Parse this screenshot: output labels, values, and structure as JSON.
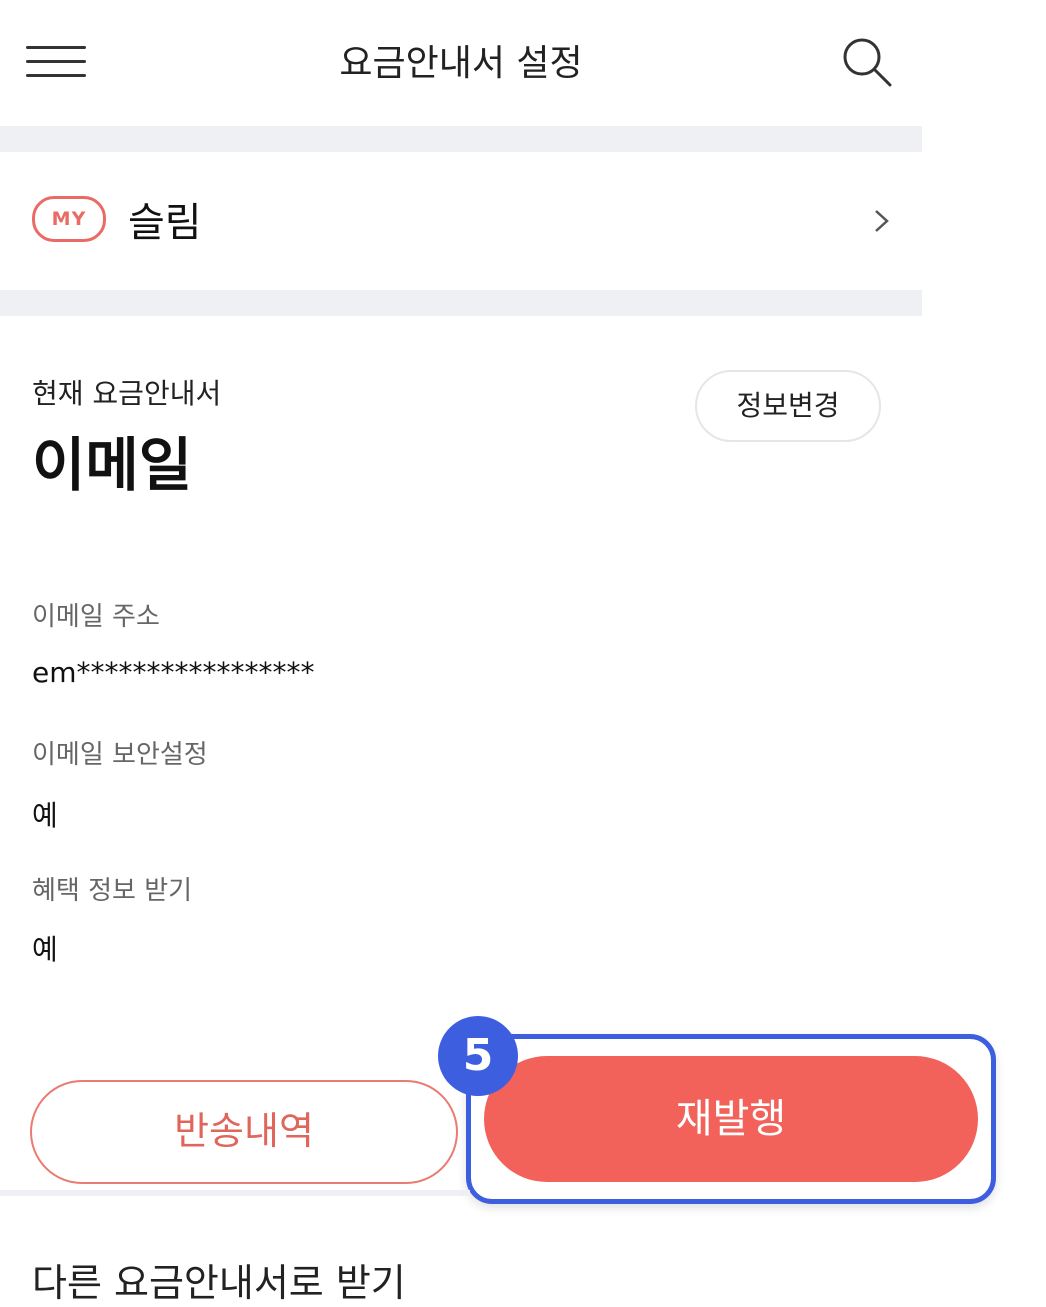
{
  "header": {
    "title": "요금안내서 설정",
    "menu_icon": "hamburger-menu-icon",
    "search_icon": "search-icon"
  },
  "my_section": {
    "badge": "MY",
    "plan_name": "슬림",
    "chevron_icon": "chevron-right-icon"
  },
  "current_bill": {
    "label": "현재 요금안내서",
    "value": "이메일",
    "change_button": "정보변경"
  },
  "fields": [
    {
      "label": "이메일 주소",
      "value": "em*****************"
    },
    {
      "label": "이메일 보안설정",
      "value": "예"
    },
    {
      "label": "혜택 정보 받기",
      "value": "예"
    }
  ],
  "actions": {
    "return_history": "반송내역",
    "reissue": "재발행",
    "step_number": "5"
  },
  "other_section": {
    "title": "다른 요금안내서로 받기"
  },
  "colors": {
    "accent_red": "#f2625a",
    "badge_red": "#ea6b64",
    "highlight_blue": "#3d5fdf",
    "separator_gray": "#eef0f3"
  }
}
